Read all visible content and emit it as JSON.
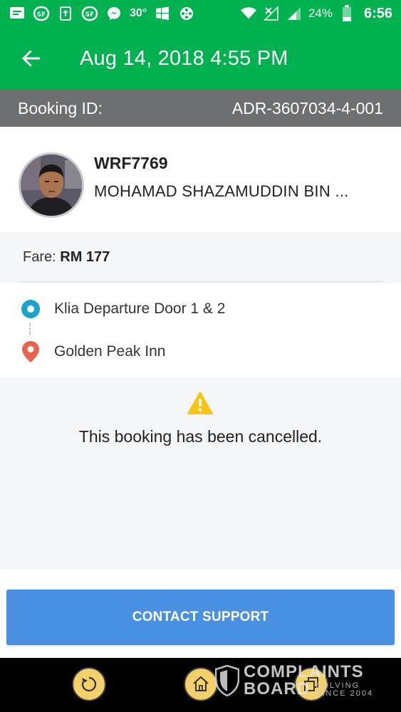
{
  "status_bar": {
    "temperature": "30°",
    "battery": "24%",
    "time": "6:56",
    "icons": [
      "message-icon",
      "sf-icon",
      "upload-icon",
      "sf-icon",
      "messenger-icon",
      "weather-icon",
      "windows-icon",
      "film-icon",
      "wifi-icon",
      "no-signal-icon",
      "signal-icon",
      "battery-icon"
    ]
  },
  "header": {
    "title": "Aug 14, 2018 4:55 PM"
  },
  "booking": {
    "label": "Booking ID:",
    "id": "ADR-3607034-4-001"
  },
  "driver": {
    "plate": "WRF7769",
    "name": "MOHAMAD SHAZAMUDDIN BIN ..."
  },
  "fare": {
    "label": "Fare:",
    "value": "RM 177"
  },
  "route": {
    "pickup": "Klia Departure Door 1 & 2",
    "dropoff": "Golden Peak Inn"
  },
  "notice": {
    "message": "This booking has been cancelled."
  },
  "actions": {
    "contact_support": "CONTACT SUPPORT"
  },
  "watermark": {
    "line1": "COMPLAINTS",
    "line2": "BOARD",
    "line3": "SOLVING",
    "line4": "SINCE 2004"
  },
  "colors": {
    "brand_green": "#00b14f",
    "booking_bar": "#6d6e72",
    "button_blue": "#4a90e2",
    "pickup_blue": "#1aa3cc",
    "dropoff_red": "#e8634a",
    "warning_yellow": "#f5c518"
  }
}
